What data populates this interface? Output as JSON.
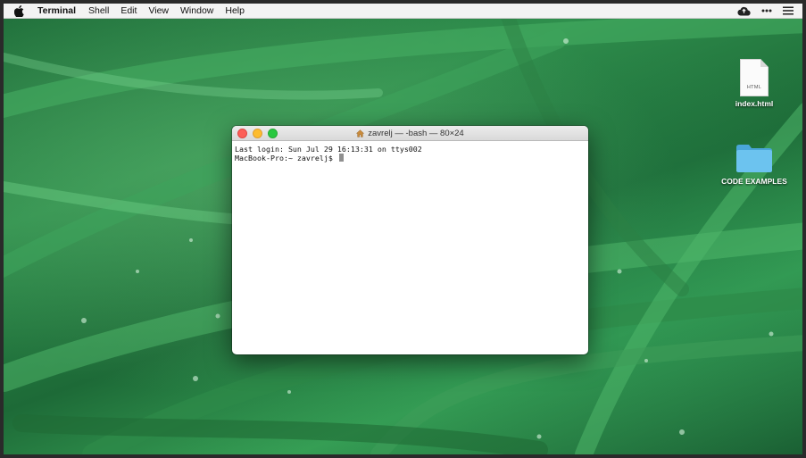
{
  "menubar": {
    "app_name": "Terminal",
    "items": [
      "Shell",
      "Edit",
      "View",
      "Window",
      "Help"
    ]
  },
  "desktop": {
    "icons": [
      {
        "label": "index.html",
        "type": "file",
        "ext": "HTML"
      },
      {
        "label": "CODE EXAMPLES",
        "type": "folder"
      }
    ]
  },
  "terminal": {
    "title": "zavrelj — -bash — 80×24",
    "lines": [
      "Last login: Sun Jul 29 16:13:31 on ttys002"
    ],
    "prompt": "MacBook-Pro:~ zavrelj$ "
  },
  "colors": {
    "wallpaper": "#2f8f4d",
    "folder": "#5bb8e8",
    "close": "#fc5f57",
    "minimize": "#fdbc2e",
    "maximize": "#28c840"
  },
  "icons": [
    "apple-icon",
    "cloud-upload-icon",
    "more-icon",
    "list-icon",
    "home-icon"
  ]
}
